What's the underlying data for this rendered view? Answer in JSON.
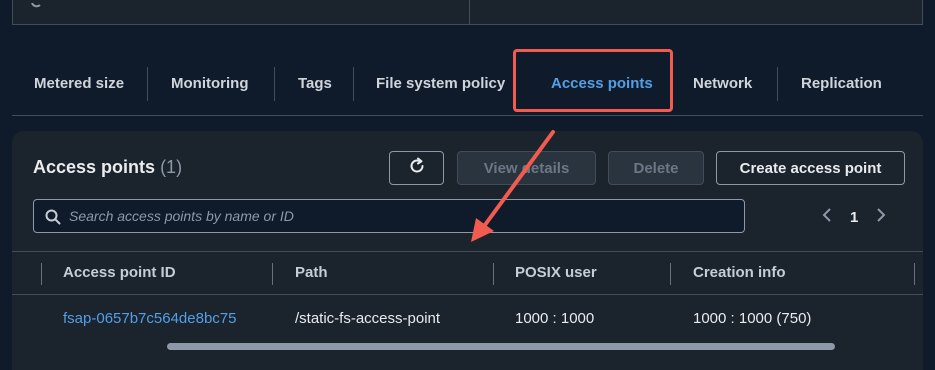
{
  "tabs": [
    {
      "label": "Metered size"
    },
    {
      "label": "Monitoring"
    },
    {
      "label": "Tags"
    },
    {
      "label": "File system policy"
    },
    {
      "label": "Access points",
      "active": true
    },
    {
      "label": "Network"
    },
    {
      "label": "Replication"
    }
  ],
  "panel": {
    "title": "Access points",
    "count": "(1)",
    "buttons": {
      "refresh_icon": "refresh-icon",
      "view_details": "View details",
      "delete": "Delete",
      "create": "Create access point"
    },
    "search": {
      "placeholder": "Search access points by name or ID"
    },
    "pagination": {
      "page": "1"
    },
    "columns": [
      "Access point ID",
      "Path",
      "POSIX user",
      "Creation info"
    ],
    "rows": [
      {
        "id": "fsap-0657b7c564de8bc75",
        "path": "/static-fs-access-point",
        "posix_user": "1000 : 1000",
        "creation_info": "1000 : 1000 (750)"
      }
    ]
  },
  "colors": {
    "accent": "#539fe5",
    "highlight": "#f15b50",
    "background": "#0f1b2a",
    "panel": "#1b232d"
  }
}
